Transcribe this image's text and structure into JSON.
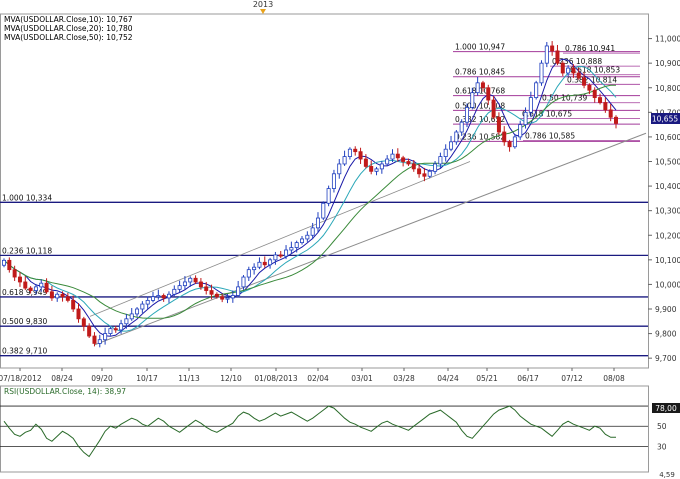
{
  "header": {
    "year_marker": "2013"
  },
  "legend": [
    {
      "text": "MVA(USDOLLAR.Close,10): 10,767",
      "color": "#1a1aa8"
    },
    {
      "text": "MVA(USDOLLAR.Close,20): 10,780",
      "color": "#2aa7b8"
    },
    {
      "text": "MVA(USDOLLAR.Close,50): 10,752",
      "color": "#3a8a3a"
    }
  ],
  "colors": {
    "up": "#1f3fbf",
    "down": "#c01a1a",
    "level": "#1a1a80",
    "fib": "#a23a9a",
    "trend": "#8c8c8c"
  },
  "last_price_label": "10,655",
  "rsi": {
    "label": "RSI(USDOLLAR.Close, 14): 38,97",
    "upper_label": "78,00",
    "lower_label": "4,59",
    "ticks": [
      "70",
      "50",
      "30"
    ]
  },
  "chart_data": [
    {
      "type": "candlestick",
      "title": "",
      "instrument": "USDOLLAR",
      "price_axis": {
        "min": 9660,
        "max": 11100,
        "ticks": [
          "11,000",
          "10,900",
          "10,800",
          "10,700",
          "10,600",
          "10,500",
          "10,400",
          "10,300",
          "10,200",
          "10,100",
          "10,000",
          "9,900",
          "9,800",
          "9,700"
        ]
      },
      "x_ticks": [
        "07/18/2012",
        "08/24",
        "09/20",
        "10/17",
        "11/13",
        "12/10",
        "01/08/2013",
        "02/04",
        "03/01",
        "03/28",
        "04/24",
        "05/21",
        "06/17",
        "07/12",
        "08/08"
      ],
      "horizontal_levels": [
        {
          "label": "1.000 10,334",
          "value": 10334
        },
        {
          "label": "0.236 10,118",
          "value": 10118
        },
        {
          "label": "0.618 9,949",
          "value": 9949
        },
        {
          "label": "0.500 9,830",
          "value": 9830
        },
        {
          "label": "0.382 9,710",
          "value": 9710
        }
      ],
      "fib_upper": [
        {
          "label": "1.000 10,947",
          "value": 10947
        },
        {
          "label": "0.786 10,845",
          "value": 10845
        },
        {
          "label": "0.618 10,768",
          "value": 10768
        },
        {
          "label": "0.500 10,708",
          "value": 10708
        },
        {
          "label": "0.382 10,652",
          "value": 10652
        },
        {
          "label": "0.236 10,582",
          "value": 10582
        }
      ],
      "fib_right": [
        {
          "label": "0.786 10,941",
          "value": 10941
        },
        {
          "label": "0.236 10,888",
          "value": 10888
        },
        {
          "label": "0.618 10,853",
          "value": 10853
        },
        {
          "label": "0.382 10,814",
          "value": 10814
        },
        {
          "label": "0.50 10,739",
          "value": 10739
        },
        {
          "label": "0.618 10,675",
          "value": 10675
        },
        {
          "label": "0.786 10,585",
          "value": 10585
        }
      ],
      "closes": [
        10098,
        10060,
        10030,
        10010,
        9985,
        9975,
        9990,
        10005,
        9970,
        9945,
        9960,
        9950,
        9935,
        9900,
        9860,
        9830,
        9790,
        9760,
        9775,
        9800,
        9820,
        9815,
        9840,
        9860,
        9880,
        9900,
        9920,
        9935,
        9950,
        9955,
        9945,
        9960,
        9980,
        9995,
        10010,
        10025,
        10010,
        9990,
        9975,
        9960,
        9950,
        9940,
        9945,
        9955,
        9990,
        10030,
        10060,
        10070,
        10090,
        10080,
        10100,
        10120,
        10115,
        10140,
        10150,
        10170,
        10185,
        10200,
        10230,
        10270,
        10330,
        10390,
        10450,
        10490,
        10520,
        10550,
        10540,
        10510,
        10480,
        10460,
        10470,
        10490,
        10510,
        10530,
        10515,
        10500,
        10490,
        10470,
        10450,
        10440,
        10460,
        10490,
        10520,
        10550,
        10580,
        10620,
        10660,
        10720,
        10780,
        10820,
        10800,
        10750,
        10680,
        10620,
        10580,
        10560,
        10600,
        10650,
        10700,
        10760,
        10820,
        10900,
        10970,
        10950,
        10900,
        10860,
        10880,
        10860,
        10840,
        10810,
        10790,
        10760,
        10740,
        10710,
        10680,
        10655
      ]
    },
    {
      "type": "line",
      "title": "",
      "name": "RSI(USDOLLAR.Close, 14)",
      "y_range": [
        4.59,
        78.0
      ],
      "levels": [
        70,
        50,
        30
      ],
      "values": [
        55,
        48,
        42,
        40,
        44,
        46,
        52,
        47,
        38,
        35,
        40,
        45,
        42,
        38,
        30,
        24,
        20,
        28,
        36,
        45,
        50,
        48,
        52,
        55,
        58,
        56,
        52,
        50,
        54,
        58,
        55,
        50,
        47,
        44,
        48,
        52,
        56,
        53,
        49,
        46,
        44,
        47,
        50,
        53,
        60,
        64,
        62,
        58,
        55,
        57,
        60,
        63,
        60,
        62,
        64,
        61,
        58,
        55,
        58,
        62,
        66,
        70,
        68,
        63,
        58,
        54,
        52,
        49,
        47,
        45,
        49,
        53,
        55,
        52,
        50,
        48,
        46,
        50,
        54,
        58,
        62,
        64,
        66,
        62,
        58,
        54,
        46,
        40,
        38,
        44,
        50,
        56,
        62,
        66,
        68,
        70,
        66,
        60,
        56,
        52,
        50,
        48,
        44,
        40,
        46,
        52,
        55,
        52,
        50,
        48,
        46,
        50,
        48,
        42,
        39,
        38.97
      ]
    }
  ]
}
